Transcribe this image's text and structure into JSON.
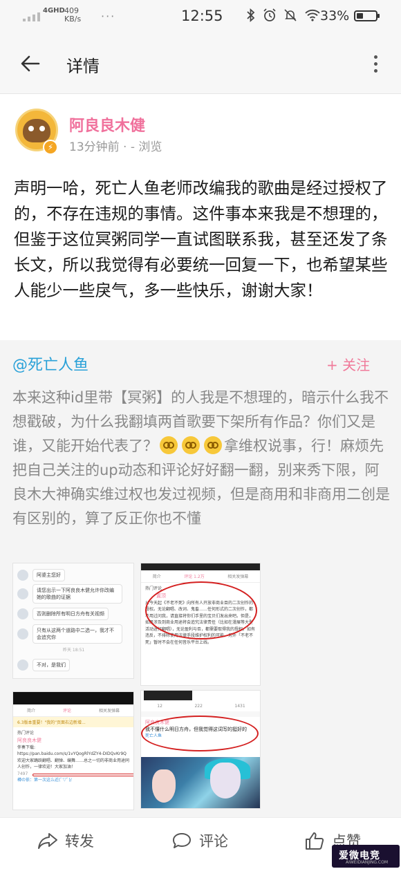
{
  "status_bar": {
    "network": "4GHD",
    "speed_value": "409",
    "speed_unit": "KB/s",
    "more_dots": "···",
    "time": "12:55",
    "battery_percent": "33%",
    "battery_level": 0.33,
    "icons": [
      "bluetooth-icon",
      "alarm-icon",
      "mute-icon",
      "wifi-icon"
    ]
  },
  "header": {
    "title": "详情"
  },
  "post": {
    "author": "阿良良木健",
    "meta": "13分钟前 · - 浏览",
    "body": "声明一哈，死亡人鱼老师改编我的歌曲是经过授权了的，不存在违规的事情。这件事本来我是不想理的，但鉴于这位冥粥同学一直试图联系我，甚至还发了条长文，所以我觉得有必要统一回复一下，也希望某些人能少一些戾气，多一些快乐，谢谢大家！"
  },
  "repost": {
    "author": "@死亡人鱼",
    "follow_label": "+ 关注",
    "text_part1": "本来这种id里带【冥粥】的人我是不想理的，暗示什么我不想戳破，为什么我翻填两首歌要下架所有作品？你们又是谁，又能开始代表了？",
    "text_part2": "拿维权说事，行！麻烦先把自己关注的up动态和评论好好翻一翻，别来秀下限，阿良木大神确实维过权也发过视频，但是商用和非商用二创是有区别的，算了反正你也不懂",
    "images": {
      "chat": {
        "messages": [
          "阿婆主您好",
          "请您出示一下阿良良木健允许你改编她的歌曲的证据",
          "否则删除所有明日方舟有关视频",
          "只有从这两个道路中二选一，我才不会追究你",
          "不对，是我们"
        ],
        "time": "昨天 18:51"
      },
      "comments": {
        "tabs": [
          "简介",
          "评论 1.2万",
          "相关发弹幕"
        ],
        "hot_label": "热门评论",
        "top_badge": "置顶",
        "text": "从今天起《不老不死》向所有人开放非商业目的二次创作的授权。无论翻唱、改词、鬼畜……任何形式的二次创作，都不用过问我，请直接将你们手里的宝贝们发出来吧。但是，如果涉及到商业用途将会追究法律责任（比如在漫展等大型活动进行翻唱），无论盈利与否，都需要取得我的授权。如有违反，不排除使用法律手段维护权利的可能。另外「不老不死」暂时不会在任何音乐平台上线。"
      },
      "reply": {
        "tabs": [
          "简介",
          "评论",
          "相关发弹幕"
        ],
        "notice": "6.3版本重要！\"我的\"页面右边新增...",
        "hot_label": "热门评论",
        "name": "阿良良木健",
        "text": "伴奏下载:\nhttps://pan.baidu.com/s/1vYQogRlYdZY4-DIDQvKr9Q\n欢迎大家踊跃翻唱、翻弹、编舞……总之一切的非商业用途同人创作，一律欢迎！大家加油！",
        "likes": "7497",
        "reply_hint": "樽の依：第一次这么近(ﾟ▽ﾟ)/"
      },
      "weibo": {
        "stats": [
          "12",
          "222",
          "1431"
        ],
        "name": "阿良良木健",
        "text": "我不懂什么明日方舟，但我觉得这词写的挺好的",
        "mention": "死亡人鱼"
      }
    }
  },
  "bottom_bar": {
    "forward": "转发",
    "comment": "评论",
    "like": "点赞"
  },
  "watermark": {
    "text": "爱微电竞",
    "sub": "AIWEIDIANJING.COM"
  }
}
